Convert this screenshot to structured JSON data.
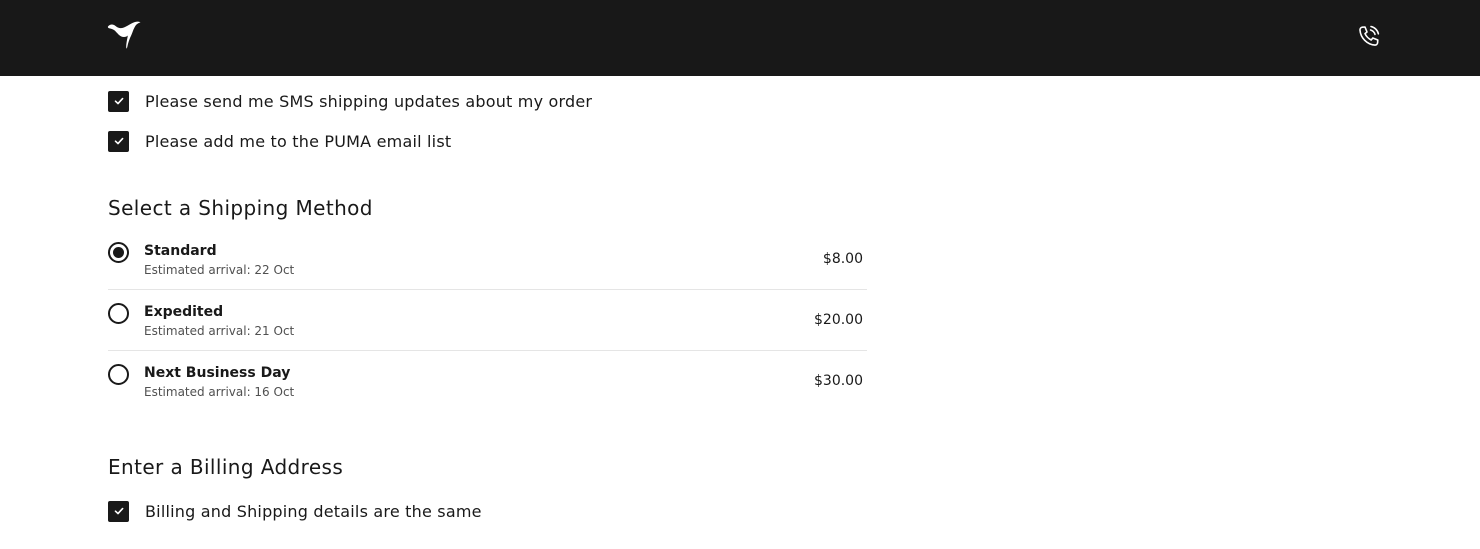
{
  "header": {
    "logo_icon": "puma-cat-logo-icon",
    "phone_icon": "phone-call-icon",
    "background": "#181818"
  },
  "preferences": {
    "sms_updates": {
      "label": "Please send me SMS shipping updates about my order",
      "checked": true
    },
    "email_list": {
      "label": "Please add me to the PUMA email list",
      "checked": true
    }
  },
  "shipping": {
    "title": "Select a Shipping Method",
    "options": [
      {
        "name": "Standard",
        "eta": "Estimated arrival: 22 Oct",
        "price": "$8.00",
        "selected": true
      },
      {
        "name": "Expedited",
        "eta": "Estimated arrival: 21 Oct",
        "price": "$20.00",
        "selected": false
      },
      {
        "name": "Next Business Day",
        "eta": "Estimated arrival: 16 Oct",
        "price": "$30.00",
        "selected": false
      }
    ]
  },
  "billing": {
    "title": "Enter a Billing Address",
    "same_as_shipping": {
      "label": "Billing and Shipping details are the same",
      "checked": true
    }
  },
  "colors": {
    "text": "#191919",
    "secondary_text": "#505050",
    "divider": "#e5e5e5"
  }
}
